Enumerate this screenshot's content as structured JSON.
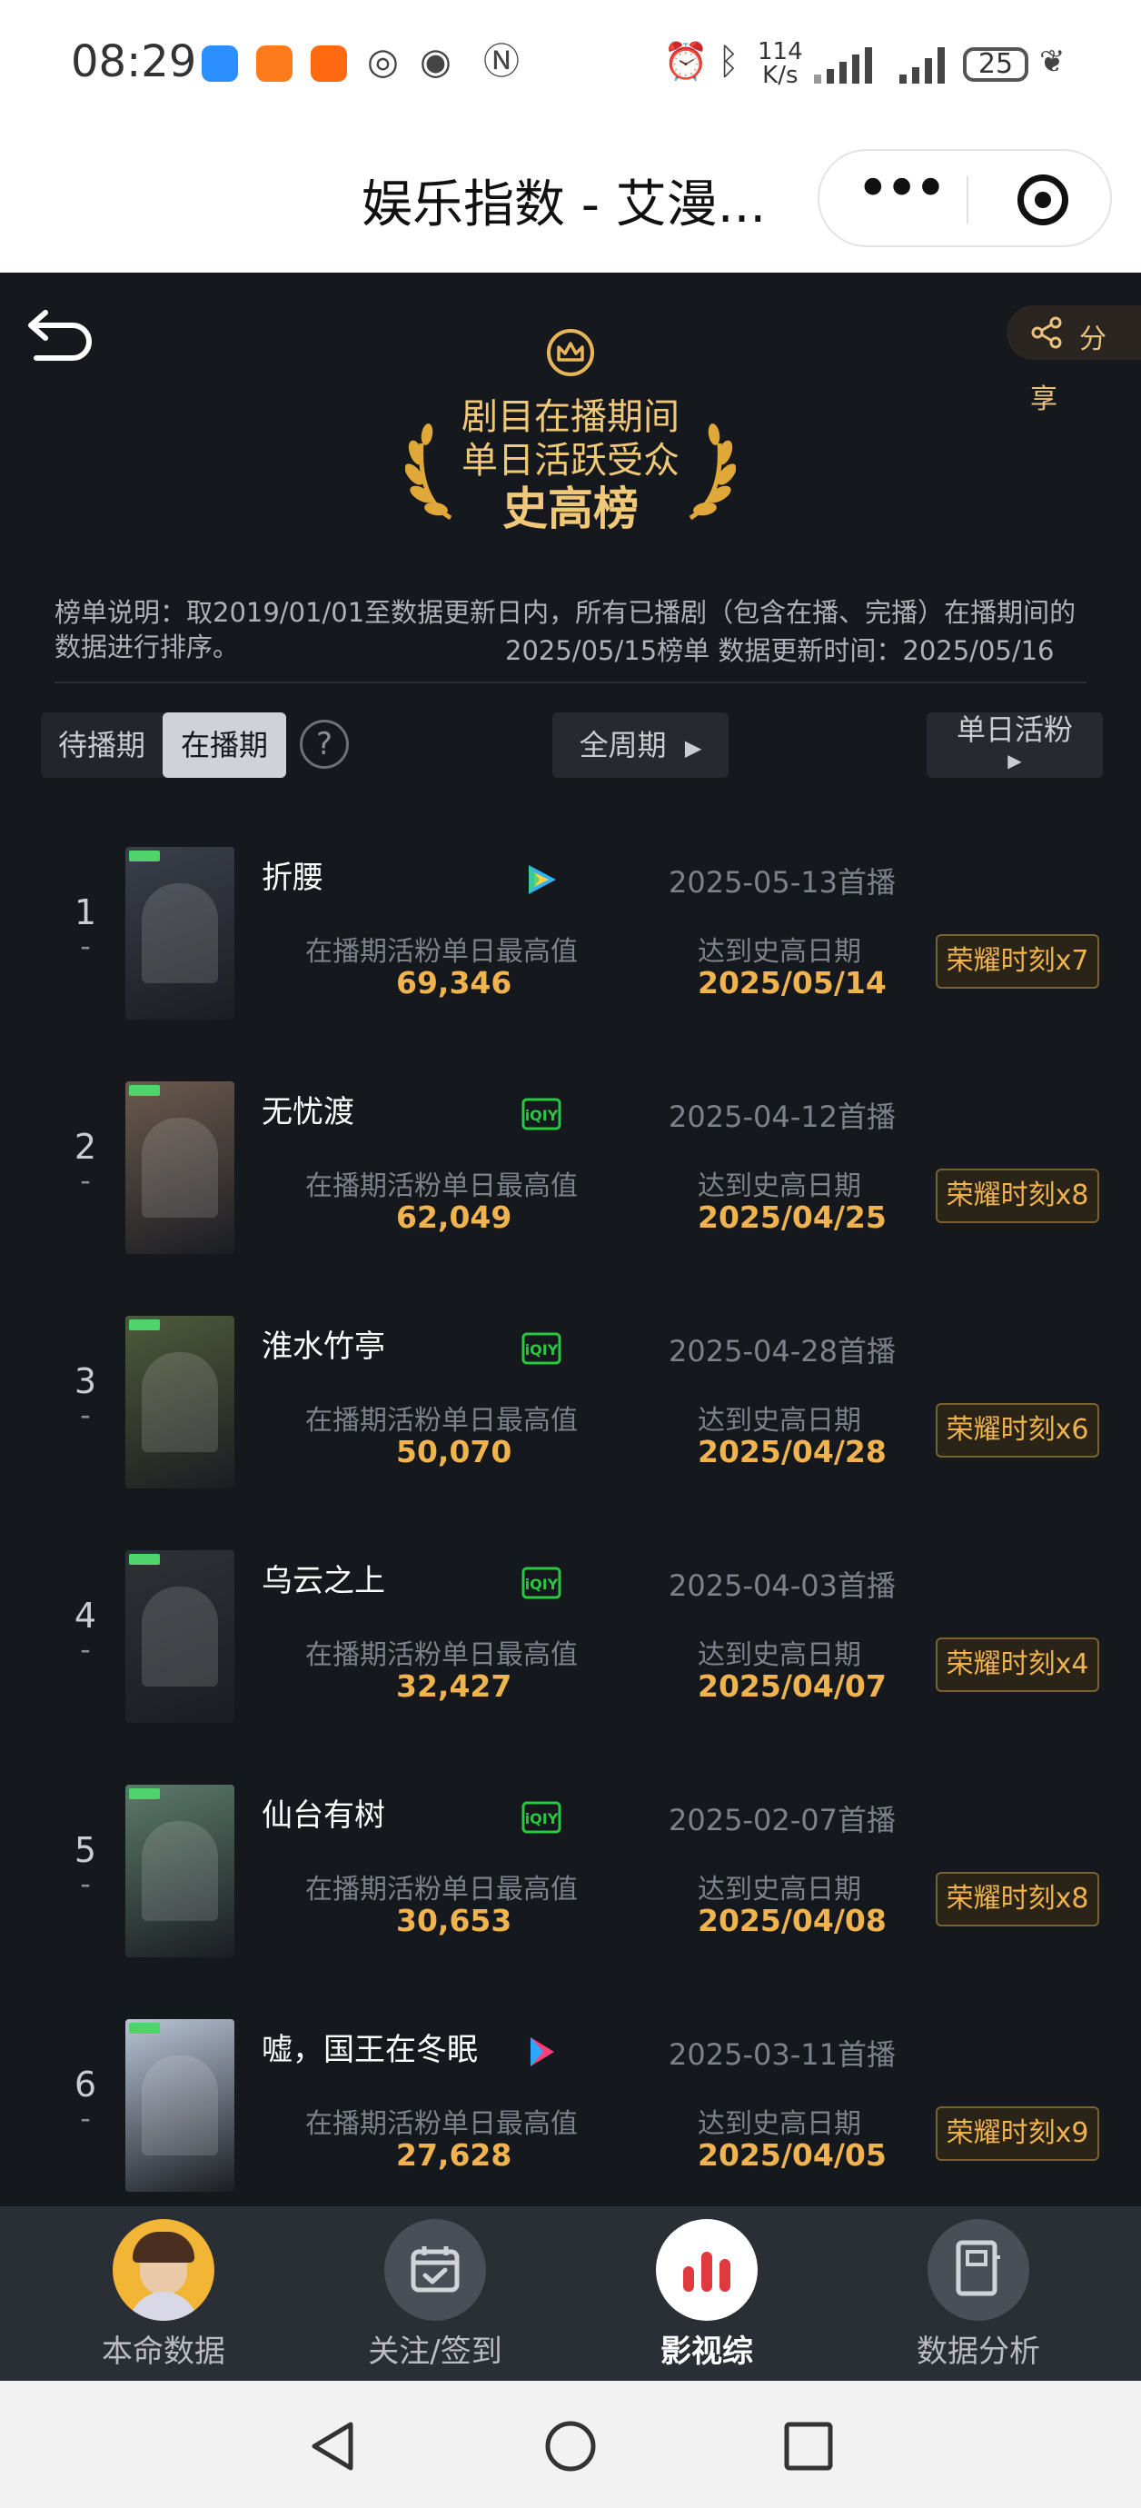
{
  "status_bar": {
    "time": "08:29",
    "net_speed_value": "114",
    "net_speed_unit": "K/s",
    "battery": "25",
    "icons": [
      "weather-icon",
      "app-notification-icon",
      "app-notification-icon",
      "nfc-auto-icon",
      "eye-icon",
      "nfc-icon",
      "alarm-icon",
      "bluetooth-icon",
      "signal-icon",
      "signal-icon",
      "battery-icon",
      "leaf-icon"
    ]
  },
  "header": {
    "title": "娱乐指数 - 艾漫...",
    "more_icon": "more-dots-icon",
    "close_icon": "target-close-icon"
  },
  "hero": {
    "line1": "剧目在播期间",
    "line2": "单日活跃受众",
    "line3": "史高榜",
    "crown_icon": "crown-icon",
    "laurel_icon": "laurel-icon"
  },
  "share": {
    "label_1": "分",
    "label_2": "享",
    "icon": "share-icon"
  },
  "description": {
    "text": "榜单说明：取2019/01/01至数据更新日内，所有已播剧（包含在播、完播）在播期间的数据进行排序。",
    "date_line": "2025/05/15榜单    数据更新时间：2025/05/16"
  },
  "filters": {
    "tab_pre": "待播期",
    "tab_on": "在播期",
    "help": "?",
    "period": "全周期",
    "metric": "单日活粉"
  },
  "columns": {
    "metric_label": "在播期活粉单日最高值",
    "date_label": "达到史高日期"
  },
  "rows": [
    {
      "rank": "1",
      "dash": "-",
      "title": "折腰",
      "platform": "tencent-video-icon",
      "premiere": "2025-05-13首播",
      "value": "69,346",
      "peak_date": "2025/05/14",
      "honor": "荣耀时刻x7",
      "poster_color": "#3b3f4a"
    },
    {
      "rank": "2",
      "dash": "-",
      "title": "无忧渡",
      "platform": "iqiyi-icon",
      "premiere": "2025-04-12首播",
      "value": "62,049",
      "peak_date": "2025/04/25",
      "honor": "荣耀时刻x8",
      "poster_color": "#6b5a4e"
    },
    {
      "rank": "3",
      "dash": "-",
      "title": "淮水竹亭",
      "platform": "iqiyi-icon",
      "premiere": "2025-04-28首播",
      "value": "50,070",
      "peak_date": "2025/04/28",
      "honor": "荣耀时刻x6",
      "poster_color": "#4f5a3a"
    },
    {
      "rank": "4",
      "dash": "-",
      "title": "乌云之上",
      "platform": "iqiyi-icon",
      "premiere": "2025-04-03首播",
      "value": "32,427",
      "peak_date": "2025/04/07",
      "honor": "荣耀时刻x4",
      "poster_color": "#2e3136"
    },
    {
      "rank": "5",
      "dash": "-",
      "title": "仙台有树",
      "platform": "iqiyi-icon",
      "premiere": "2025-02-07首播",
      "value": "30,653",
      "peak_date": "2025/04/08",
      "honor": "荣耀时刻x8",
      "poster_color": "#5b7a6a"
    },
    {
      "rank": "6",
      "dash": "-",
      "title": "嘘，国王在冬眠",
      "platform": "youku-icon",
      "premiere": "2025-03-11首播",
      "value": "27,628",
      "peak_date": "2025/04/05",
      "honor": "荣耀时刻x9",
      "poster_color": "#b8c4d6"
    }
  ],
  "bottom_nav": [
    {
      "label": "本命数据",
      "icon": "avatar-icon",
      "active": false
    },
    {
      "label": "关注/签到",
      "icon": "calendar-check-icon",
      "active": false
    },
    {
      "label": "影视综",
      "icon": "bar-chart-icon",
      "active": true
    },
    {
      "label": "数据分析",
      "icon": "document-icon",
      "active": false
    }
  ],
  "colors": {
    "background": "#15181d",
    "gold": "#f0b34e",
    "hero_gold": "#f0c878",
    "muted": "#7d8289"
  }
}
